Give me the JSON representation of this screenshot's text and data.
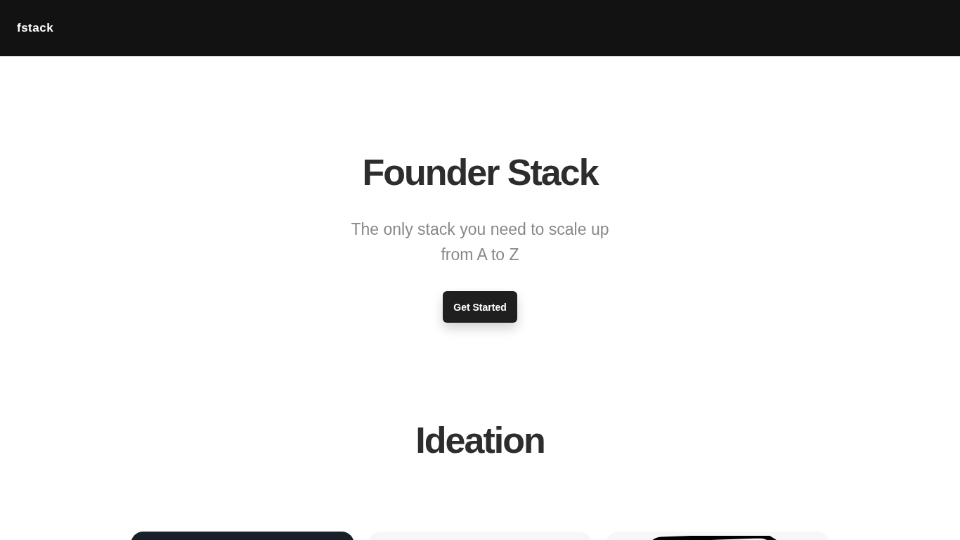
{
  "nav": {
    "brand": "fstack"
  },
  "hero": {
    "title": "Founder Stack",
    "subtitle": "The only stack you need to scale up from A to Z",
    "button": "Get Started"
  },
  "section": {
    "title": "Ideation",
    "cards": [
      {
        "kind": "dark"
      },
      {
        "kind": "light"
      },
      {
        "kind": "frame"
      }
    ]
  }
}
